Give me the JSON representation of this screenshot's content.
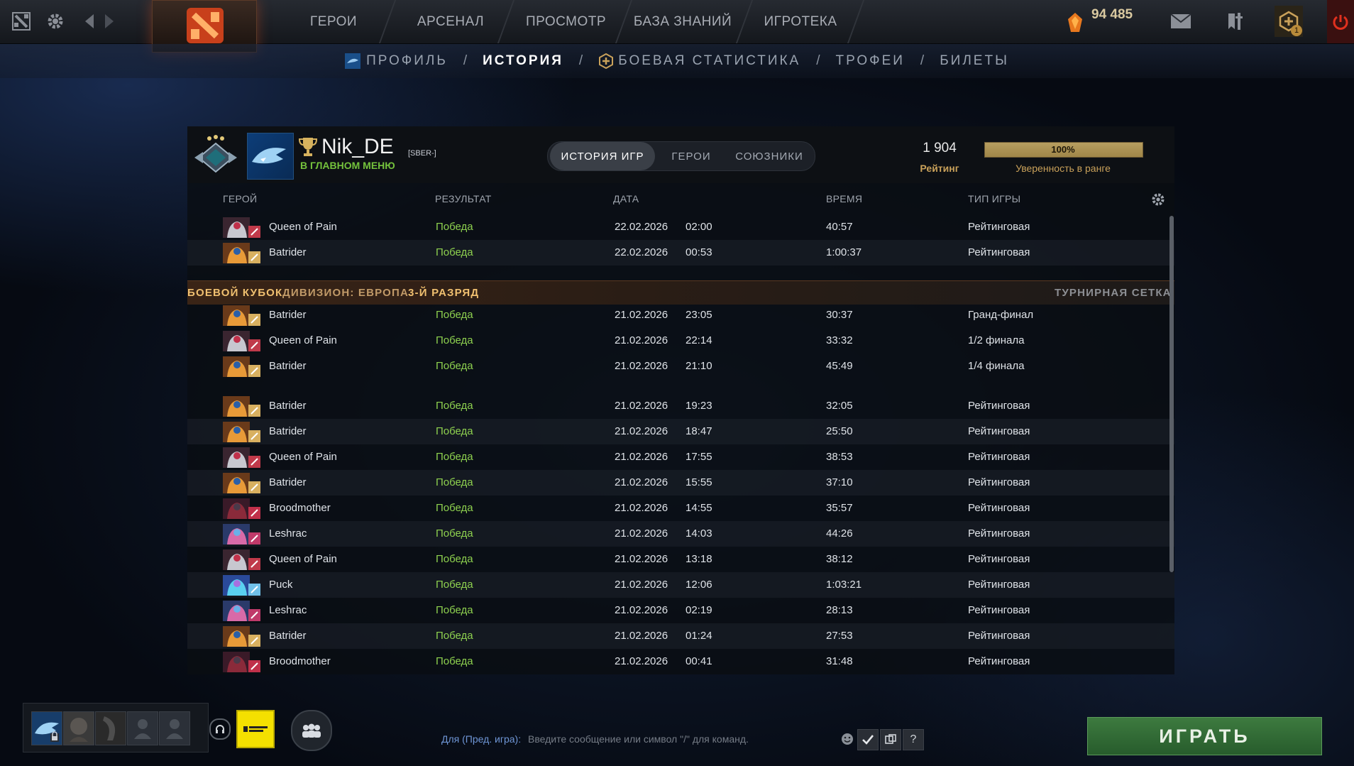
{
  "topbar": {
    "nav": [
      "ГЕРОИ",
      "АРСЕНАЛ",
      "ПРОСМОТР",
      "БАЗА ЗНАНИЙ",
      "ИГРОТЕКА"
    ],
    "currency": "94 485",
    "plus_badge": "1"
  },
  "subnav": {
    "profile": "ПРОФИЛЬ",
    "history": "ИСТОРИЯ",
    "battle_stats": "БОЕВАЯ СТАТИСТИКА",
    "trophies": "ТРОФЕИ",
    "tickets": "БИЛЕТЫ",
    "separator": "/"
  },
  "player": {
    "name": "Nik_DE",
    "tag": "[SBER-]",
    "status": "В ГЛАВНОМ МЕНЮ",
    "rating_value": "1 904",
    "rating_label": "Рейтинг",
    "confidence_value": "100%",
    "confidence_fraction": 1.0,
    "confidence_label": "Уверенность в ранге"
  },
  "tabs": [
    "ИСТОРИЯ ИГР",
    "ГЕРОИ",
    "СОЮЗНИКИ"
  ],
  "columns": {
    "hero": "ГЕРОЙ",
    "result": "РЕЗУЛЬТАТ",
    "date": "ДАТА",
    "duration": "ВРЕМЯ",
    "mode": "ТИП ИГРЫ"
  },
  "cup_banner": {
    "title": "БОЕВОЙ КУБОК",
    "division": "ДИВИЗИОН: ЕВРОПА",
    "tier": "3-Й РАЗРЯД",
    "bracket": "ТУРНИРНАЯ СЕТКА"
  },
  "matches_before_cup": [
    {
      "hero": "Queen of Pain",
      "hero_key": "qop",
      "result": "Победа",
      "date": "22.02.2026",
      "time": "02:00",
      "duration": "40:57",
      "mode": "Рейтинговая"
    },
    {
      "hero": "Batrider",
      "hero_key": "bat",
      "result": "Победа",
      "date": "22.02.2026",
      "time": "00:53",
      "duration": "1:00:37",
      "mode": "Рейтинговая"
    }
  ],
  "matches_cup": [
    {
      "hero": "Batrider",
      "hero_key": "bat",
      "result": "Победа",
      "date": "21.02.2026",
      "time": "23:05",
      "duration": "30:37",
      "mode": "Гранд-финал"
    },
    {
      "hero": "Queen of Pain",
      "hero_key": "qop",
      "result": "Победа",
      "date": "21.02.2026",
      "time": "22:14",
      "duration": "33:32",
      "mode": "1/2 финала"
    },
    {
      "hero": "Batrider",
      "hero_key": "bat",
      "result": "Победа",
      "date": "21.02.2026",
      "time": "21:10",
      "duration": "45:49",
      "mode": "1/4 финала"
    }
  ],
  "matches_after_cup": [
    {
      "hero": "Batrider",
      "hero_key": "bat",
      "result": "Победа",
      "date": "21.02.2026",
      "time": "19:23",
      "duration": "32:05",
      "mode": "Рейтинговая"
    },
    {
      "hero": "Batrider",
      "hero_key": "bat",
      "result": "Победа",
      "date": "21.02.2026",
      "time": "18:47",
      "duration": "25:50",
      "mode": "Рейтинговая"
    },
    {
      "hero": "Queen of Pain",
      "hero_key": "qop",
      "result": "Победа",
      "date": "21.02.2026",
      "time": "17:55",
      "duration": "38:53",
      "mode": "Рейтинговая"
    },
    {
      "hero": "Batrider",
      "hero_key": "bat",
      "result": "Победа",
      "date": "21.02.2026",
      "time": "15:55",
      "duration": "37:10",
      "mode": "Рейтинговая"
    },
    {
      "hero": "Broodmother",
      "hero_key": "brood",
      "result": "Победа",
      "date": "21.02.2026",
      "time": "14:55",
      "duration": "35:57",
      "mode": "Рейтинговая"
    },
    {
      "hero": "Leshrac",
      "hero_key": "lesh",
      "result": "Победа",
      "date": "21.02.2026",
      "time": "14:03",
      "duration": "44:26",
      "mode": "Рейтинговая"
    },
    {
      "hero": "Queen of Pain",
      "hero_key": "qop",
      "result": "Победа",
      "date": "21.02.2026",
      "time": "13:18",
      "duration": "38:12",
      "mode": "Рейтинговая"
    },
    {
      "hero": "Puck",
      "hero_key": "puck",
      "result": "Победа",
      "date": "21.02.2026",
      "time": "12:06",
      "duration": "1:03:21",
      "mode": "Рейтинговая"
    },
    {
      "hero": "Leshrac",
      "hero_key": "lesh",
      "result": "Победа",
      "date": "21.02.2026",
      "time": "02:19",
      "duration": "28:13",
      "mode": "Рейтинговая"
    },
    {
      "hero": "Batrider",
      "hero_key": "bat",
      "result": "Победа",
      "date": "21.02.2026",
      "time": "01:24",
      "duration": "27:53",
      "mode": "Рейтинговая"
    },
    {
      "hero": "Broodmother",
      "hero_key": "brood",
      "result": "Победа",
      "date": "21.02.2026",
      "time": "00:41",
      "duration": "31:48",
      "mode": "Рейтинговая"
    }
  ],
  "chat": {
    "channel": "Для (Пред. игра):",
    "placeholder": "Введите сообщение или символ \"/\" для команд.",
    "help": "?"
  },
  "play_button": "ИГРАТЬ",
  "colors": {
    "win": "#8ed14f",
    "status": "#74c23c",
    "rating_label": "#c9a15a",
    "cup_orange": "#e8a04a",
    "play_green": "#3d7a3f"
  }
}
